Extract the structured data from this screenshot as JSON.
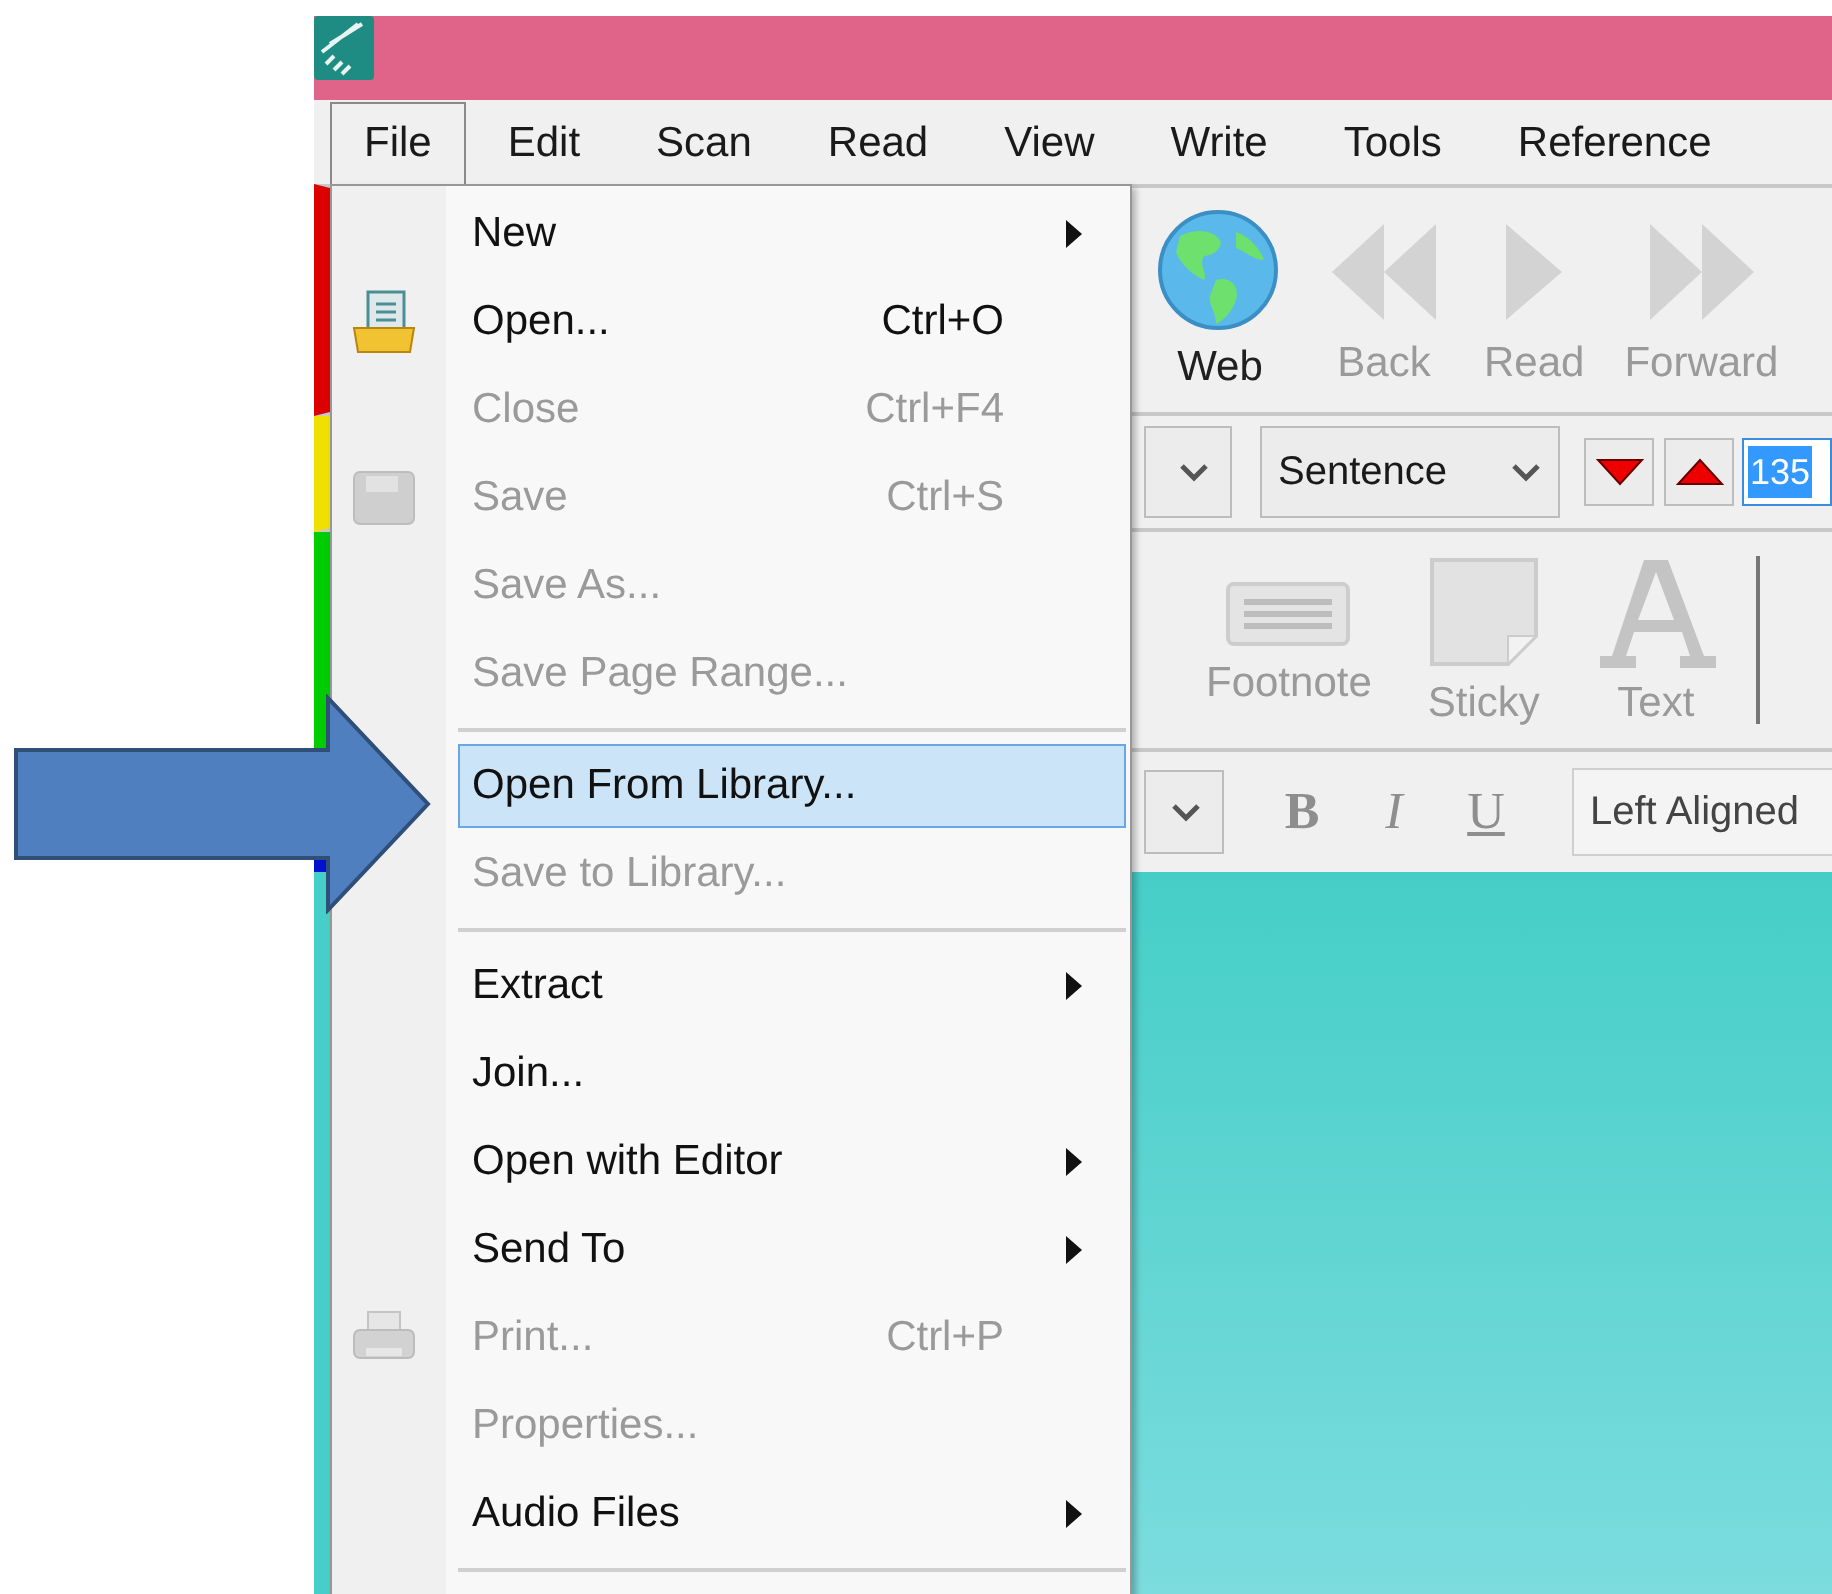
{
  "menu_bar": [
    {
      "label": "File",
      "selected": true
    },
    {
      "label": "Edit",
      "selected": false
    },
    {
      "label": "Scan",
      "selected": false
    },
    {
      "label": "Read",
      "selected": false
    },
    {
      "label": "View",
      "selected": false
    },
    {
      "label": "Write",
      "selected": false
    },
    {
      "label": "Tools",
      "selected": false
    },
    {
      "label": "Reference",
      "selected": false
    }
  ],
  "file_menu": {
    "groups": [
      [
        {
          "label": "New",
          "kind": "plain",
          "submenu": true,
          "disabled": false,
          "selected": false
        },
        {
          "label": "Open...",
          "shortcut": "Ctrl+O",
          "kind": "open",
          "submenu": false,
          "disabled": false,
          "selected": false
        },
        {
          "label": "Close",
          "shortcut": "Ctrl+F4",
          "kind": "plain",
          "submenu": false,
          "disabled": true,
          "selected": false
        },
        {
          "label": "Save",
          "shortcut": "Ctrl+S",
          "kind": "save",
          "submenu": false,
          "disabled": true,
          "selected": false
        },
        {
          "label": "Save As...",
          "kind": "plain",
          "submenu": false,
          "disabled": true,
          "selected": false
        },
        {
          "label": "Save Page Range...",
          "kind": "plain",
          "submenu": false,
          "disabled": true,
          "selected": false
        }
      ],
      [
        {
          "label": "Open From Library...",
          "kind": "plain",
          "submenu": false,
          "disabled": false,
          "selected": true
        },
        {
          "label": "Save to Library...",
          "kind": "plain",
          "submenu": false,
          "disabled": true,
          "selected": false
        }
      ],
      [
        {
          "label": "Extract",
          "kind": "plain",
          "submenu": true,
          "disabled": false,
          "selected": false
        },
        {
          "label": "Join...",
          "kind": "plain",
          "submenu": false,
          "disabled": false,
          "selected": false
        },
        {
          "label": "Open with Editor",
          "kind": "plain",
          "submenu": true,
          "disabled": false,
          "selected": false
        },
        {
          "label": "Send To",
          "kind": "plain",
          "submenu": true,
          "disabled": false,
          "selected": false
        },
        {
          "label": "Print...",
          "shortcut": "Ctrl+P",
          "kind": "print",
          "submenu": false,
          "disabled": true,
          "selected": false
        },
        {
          "label": "Properties...",
          "kind": "plain",
          "submenu": false,
          "disabled": true,
          "selected": false
        },
        {
          "label": "Audio Files",
          "kind": "plain",
          "submenu": true,
          "disabled": false,
          "selected": false
        }
      ]
    ]
  },
  "toolbar": {
    "nav_buttons": [
      {
        "label": "Web",
        "kind": "globe",
        "disabled": false
      },
      {
        "label": "Back",
        "kind": "back",
        "disabled": true
      },
      {
        "label": "Read",
        "kind": "play",
        "disabled": true
      },
      {
        "label": "Forward",
        "kind": "forward",
        "disabled": true
      }
    ],
    "reading_unit": "Sentence",
    "page_field": "135",
    "annotate_buttons": [
      {
        "label": "Footnote",
        "kind": "footnote",
        "disabled": true
      },
      {
        "label": "Sticky",
        "kind": "sticky",
        "disabled": true
      },
      {
        "label": "Text",
        "kind": "text",
        "disabled": true
      }
    ],
    "format_buttons": [
      {
        "label": "B",
        "kind": "bold",
        "disabled": true
      },
      {
        "label": "I",
        "kind": "italic",
        "disabled": true
      },
      {
        "label": "U",
        "kind": "underline",
        "disabled": true
      }
    ],
    "alignment": "Left Aligned"
  }
}
